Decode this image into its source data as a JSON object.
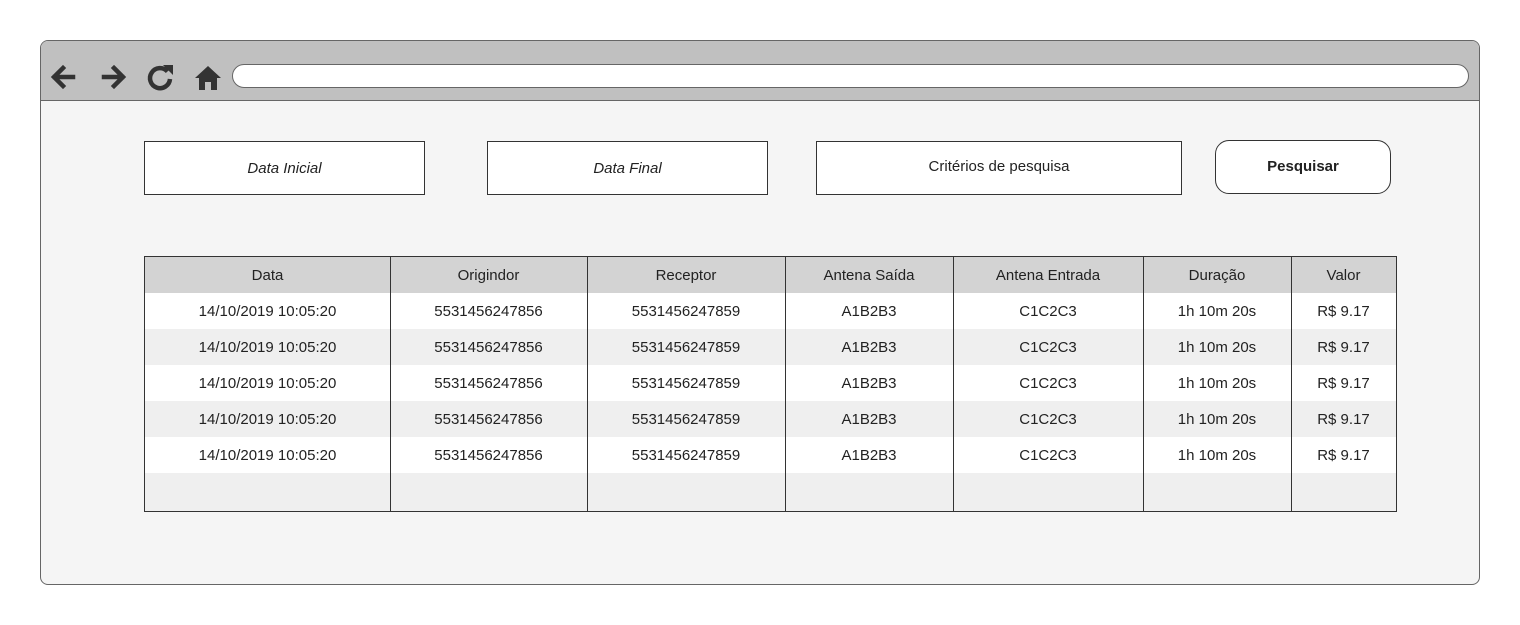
{
  "browser": {
    "icons": [
      "arrow-left-icon",
      "arrow-right-icon",
      "refresh-icon",
      "home-icon"
    ],
    "url": ""
  },
  "filters": {
    "start_date": "Data Inicial",
    "end_date": "Data Final",
    "criteria": "Critérios de pesquisa",
    "search_button": "Pesquisar"
  },
  "table": {
    "columns": [
      "Data",
      "Origindor",
      "Receptor",
      "Antena Saída",
      "Antena Entrada",
      "Duração",
      "Valor"
    ],
    "rows": [
      [
        "14/10/2019 10:05:20",
        "5531456247856",
        "5531456247859",
        "A1B2B3",
        "C1C2C3",
        "1h 10m 20s",
        "R$ 9.17"
      ],
      [
        "14/10/2019 10:05:20",
        "5531456247856",
        "5531456247859",
        "A1B2B3",
        "C1C2C3",
        "1h 10m 20s",
        "R$ 9.17"
      ],
      [
        "14/10/2019 10:05:20",
        "5531456247856",
        "5531456247859",
        "A1B2B3",
        "C1C2C3",
        "1h 10m 20s",
        "R$ 9.17"
      ],
      [
        "14/10/2019 10:05:20",
        "5531456247856",
        "5531456247859",
        "A1B2B3",
        "C1C2C3",
        "1h 10m 20s",
        "R$ 9.17"
      ],
      [
        "14/10/2019 10:05:20",
        "5531456247856",
        "5531456247859",
        "A1B2B3",
        "C1C2C3",
        "1h 10m 20s",
        "R$ 9.17"
      ]
    ]
  },
  "colors": {
    "toolbar": "#c0c0c0",
    "page": "#f5f5f5",
    "header_row": "#d3d3d3",
    "striped_row": "#efefef",
    "border": "#333333"
  }
}
